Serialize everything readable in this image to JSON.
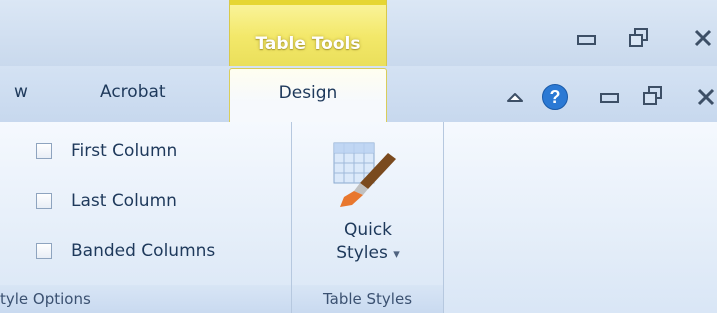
{
  "contextual": {
    "title": "Table Tools"
  },
  "tabs": {
    "partial": "w",
    "acrobat": "Acrobat",
    "design": "Design"
  },
  "options": {
    "items": [
      "First Column",
      "Last Column",
      "Banded Columns"
    ],
    "group_label": "tyle Options"
  },
  "styles": {
    "button_line1": "Quick",
    "button_line2": "Styles",
    "dropdown_glyph": "▾",
    "group_label": "Table Styles"
  },
  "window": {
    "minimize_glyph": "▭",
    "restore_glyph": "🗗",
    "close_glyph": "✕",
    "help_glyph": "?",
    "collapse_glyph": "⌃"
  },
  "colors": {
    "contextual_yellow": "#f3e86a",
    "help_blue": "#2b79d4"
  }
}
